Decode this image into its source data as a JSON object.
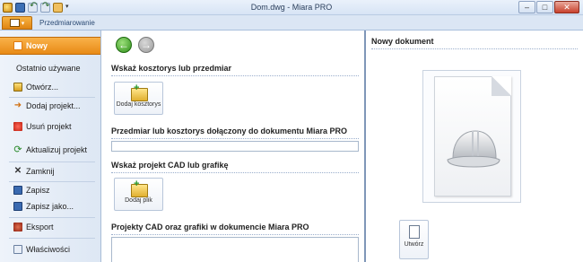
{
  "window": {
    "title": "Dom.dwg - Miara PRO",
    "controls": {
      "minimize": "–",
      "maximize": "□",
      "close": "✕"
    }
  },
  "quick_access": [
    "app-logo-icon",
    "save-icon",
    "undo-icon",
    "redo-icon",
    "tool-icon",
    "customize-dropdown-icon"
  ],
  "ribbon": {
    "file_tab_icon": "file-menu-icon",
    "tabs": [
      "Przedmiarowanie"
    ]
  },
  "sidebar": {
    "items": [
      {
        "label": "Nowy",
        "icon": "new-page-icon",
        "active": true
      },
      {
        "label": "Ostatnio używane",
        "icon": "",
        "active": false
      },
      {
        "label": "Otwórz...",
        "icon": "open-folder-icon",
        "active": false
      },
      {
        "label": "Dodaj projekt...",
        "icon": "add-arrow-icon",
        "active": false
      },
      {
        "label": "Usuń projekt",
        "icon": "delete-icon",
        "active": false
      },
      {
        "label": "Aktualizuj projekt",
        "icon": "refresh-icon",
        "active": false
      },
      {
        "label": "Zamknij",
        "icon": "close-icon",
        "active": false
      },
      {
        "label": "Zapisz",
        "icon": "save-icon",
        "active": false
      },
      {
        "label": "Zapisz jako...",
        "icon": "save-as-icon",
        "active": false
      },
      {
        "label": "Eksport",
        "icon": "export-icon",
        "active": false
      },
      {
        "label": "Właściwości",
        "icon": "properties-icon",
        "active": false
      }
    ]
  },
  "center": {
    "nav": {
      "back_icon": "back-arrow-icon",
      "forward_icon": "forward-arrow-icon"
    },
    "section_estimate": {
      "title": "Wskaż kosztorys lub przedmiar",
      "button_label": "Dodaj kosztorys"
    },
    "section_attached_estimate": {
      "title": "Przedmiar lub kosztorys dołączony do dokumentu Miara PRO",
      "value": ""
    },
    "section_cad": {
      "title": "Wskaż projekt CAD lub grafikę",
      "button_label": "Dodaj plik"
    },
    "section_attached_cad": {
      "title": "Projekty CAD oraz grafiki w dokumencie Miara PRO",
      "value": ""
    }
  },
  "right": {
    "title": "Nowy dokument",
    "preview_icon": "helmet-document-icon",
    "create_label": "Utwórz"
  }
}
